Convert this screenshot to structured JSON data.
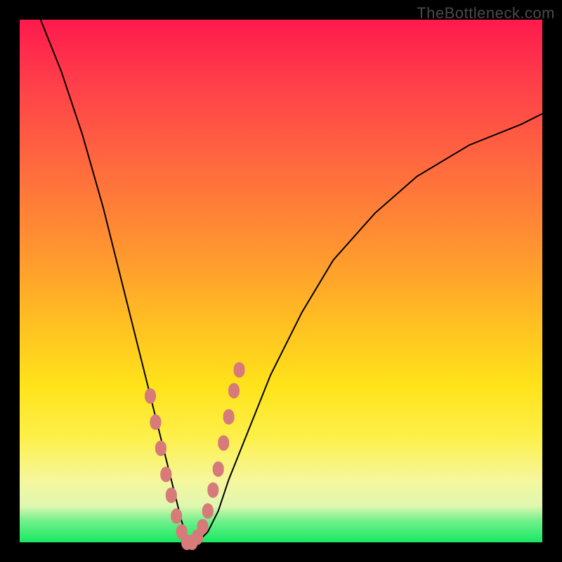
{
  "watermark": "TheBottleneck.com",
  "colors": {
    "background": "#000000",
    "curve": "#000000",
    "marker": "#d77a7a"
  },
  "chart_data": {
    "type": "line",
    "title": "",
    "xlabel": "",
    "ylabel": "",
    "xlim": [
      0,
      100
    ],
    "ylim": [
      0,
      100
    ],
    "grid": false,
    "series": [
      {
        "name": "bottleneck-curve",
        "x": [
          4,
          8,
          12,
          16,
          20,
          22,
          24,
          26,
          28,
          30,
          31,
          32,
          33,
          34,
          36,
          38,
          40,
          44,
          48,
          54,
          60,
          68,
          76,
          86,
          96,
          100
        ],
        "y": [
          100,
          90,
          78,
          64,
          48,
          40,
          32,
          24,
          16,
          8,
          4,
          1,
          0,
          0,
          2,
          6,
          12,
          22,
          32,
          44,
          54,
          63,
          70,
          76,
          80,
          82
        ]
      }
    ],
    "markers": {
      "name": "highlight-points",
      "x": [
        25,
        26,
        27,
        28,
        29,
        30,
        31,
        32,
        33,
        34,
        35,
        36,
        37,
        38,
        39,
        40,
        41,
        42
      ],
      "y": [
        28,
        23,
        18,
        13,
        9,
        5,
        2,
        0,
        0,
        1,
        3,
        6,
        10,
        14,
        19,
        24,
        29,
        33
      ]
    }
  }
}
